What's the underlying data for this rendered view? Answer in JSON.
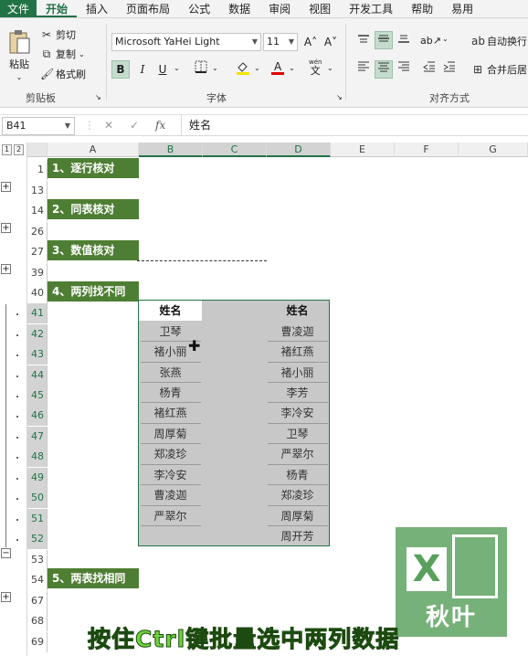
{
  "tabs": [
    "文件",
    "开始",
    "插入",
    "页面布局",
    "公式",
    "数据",
    "审阅",
    "视图",
    "开发工具",
    "帮助",
    "易用"
  ],
  "active_tab": "开始",
  "clipboard": {
    "paste_label": "粘贴",
    "cut_label": "剪切",
    "copy_label": "复制",
    "format_painter_label": "格式刷",
    "group_label": "剪贴板"
  },
  "font": {
    "name": "Microsoft YaHei Light",
    "size": "11",
    "grow_glyph": "A˄",
    "shrink_glyph": "A˅",
    "bold": "B",
    "italic": "I",
    "underline": "U",
    "phonetic_top": "wén",
    "phonetic_bottom": "文",
    "group_label": "字体"
  },
  "alignment": {
    "wrap_label": "自动换行",
    "merge_label": "合并后居",
    "group_label": "对齐方式"
  },
  "formula_bar": {
    "name_box": "B41",
    "fx": "fx",
    "content": "姓名"
  },
  "outline_levels": [
    "1",
    "2"
  ],
  "columns": [
    "A",
    "B",
    "C",
    "D",
    "E",
    "F",
    "G"
  ],
  "selected_columns": [
    "B",
    "C",
    "D"
  ],
  "rows": [
    "1",
    "13",
    "14",
    "26",
    "27",
    "39",
    "40",
    "41",
    "42",
    "43",
    "44",
    "45",
    "46",
    "47",
    "48",
    "49",
    "50",
    "51",
    "52",
    "53",
    "54",
    "67",
    "68",
    "69"
  ],
  "selected_rows": [
    "41",
    "42",
    "43",
    "44",
    "45",
    "46",
    "47",
    "48",
    "49",
    "50",
    "51",
    "52"
  ],
  "section_headers": [
    {
      "row": "1",
      "text": "1、逐行核对"
    },
    {
      "row": "14",
      "text": "2、同表核对"
    },
    {
      "row": "27",
      "text": "3、数值核对"
    },
    {
      "row": "40",
      "text": "4、两列找不同"
    },
    {
      "row": "54",
      "text": "5、两表找相同"
    }
  ],
  "col_b": [
    "姓名",
    "卫琴",
    "褚小丽",
    "张燕",
    "杨青",
    "褚红燕",
    "周厚菊",
    "郑凌珍",
    "李冷安",
    "曹凌迦",
    "严翠尔"
  ],
  "col_d": [
    "姓名",
    "曹凌迦",
    "褚红燕",
    "褚小丽",
    "李芳",
    "李冷安",
    "卫琴",
    "严翠尔",
    "杨青",
    "郑凌珍",
    "周厚菊",
    "周开芳"
  ],
  "logo_text": "秋叶",
  "logo_letter": "X",
  "caption": "按住Ctrl键批量选中两列数据",
  "colors": {
    "excel_green": "#217346",
    "header_fill": "#4e7e33",
    "selection_gray": "#c8c8c8",
    "caption_green": "#6fd33d"
  }
}
